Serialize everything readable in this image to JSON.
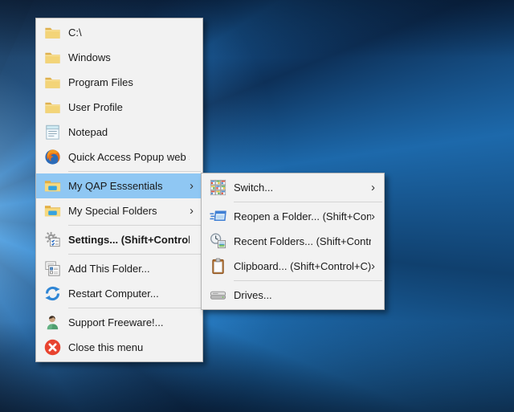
{
  "desktop": {
    "description": "Windows 10 hero wallpaper desktop"
  },
  "colors": {
    "highlight": "#8fc7f3",
    "menu_bg": "#f2f2f2",
    "menu_text": "#1a1a1a",
    "separator": "#d4d4d4"
  },
  "menu": {
    "name": "Quick Access Popup main menu",
    "items": [
      {
        "id": "c-drive",
        "label": "C:\\",
        "icon": "folder-icon",
        "submenu": false,
        "separator_after": false
      },
      {
        "id": "windows",
        "label": "Windows",
        "icon": "folder-icon",
        "submenu": false,
        "separator_after": false
      },
      {
        "id": "program-files",
        "label": "Program Files",
        "icon": "folder-icon",
        "submenu": false,
        "separator_after": false
      },
      {
        "id": "user-profile",
        "label": "User Profile",
        "icon": "folder-icon",
        "submenu": false,
        "separator_after": false
      },
      {
        "id": "notepad",
        "label": "Notepad",
        "icon": "notepad-icon",
        "submenu": false,
        "separator_after": false
      },
      {
        "id": "qap-web-site",
        "label": "Quick Access Popup web site",
        "icon": "firefox-icon",
        "submenu": false,
        "separator_after": true
      },
      {
        "id": "my-qap-essentials",
        "label": "My QAP Esssentials",
        "icon": "live-folder-icon",
        "submenu": true,
        "highlighted": true,
        "separator_after": false
      },
      {
        "id": "my-special-folders",
        "label": "My Special Folders",
        "icon": "live-folder-icon",
        "submenu": true,
        "separator_after": true
      },
      {
        "id": "settings",
        "label": "Settings... (Shift+Control+S)",
        "icon": "settings-icon",
        "submenu": false,
        "bold": true,
        "separator_after": true
      },
      {
        "id": "add-this-folder",
        "label": "Add This Folder...",
        "icon": "add-folder-icon",
        "submenu": false,
        "separator_after": false
      },
      {
        "id": "restart-computer",
        "label": "Restart Computer...",
        "icon": "restart-icon",
        "submenu": false,
        "separator_after": true
      },
      {
        "id": "support-freeware",
        "label": "Support Freeware!...",
        "icon": "support-icon",
        "submenu": false,
        "separator_after": false
      },
      {
        "id": "close-this-menu",
        "label": "Close this menu",
        "icon": "close-icon",
        "submenu": false,
        "separator_after": false
      }
    ]
  },
  "submenu": {
    "name": "My QAP Essentials submenu",
    "items": [
      {
        "id": "switch",
        "label": "Switch...",
        "icon": "switch-icon",
        "submenu": true,
        "separator_after": true
      },
      {
        "id": "reopen-a-folder",
        "label": "Reopen a Folder... (Shift+Control+F)",
        "icon": "reopen-icon",
        "submenu": true,
        "separator_after": false
      },
      {
        "id": "recent-folders",
        "label": "Recent Folders... (Shift+Control+R)",
        "icon": "recent-icon",
        "submenu": false,
        "separator_after": false
      },
      {
        "id": "clipboard",
        "label": "Clipboard... (Shift+Control+C)",
        "icon": "clipboard-icon",
        "submenu": true,
        "separator_after": true
      },
      {
        "id": "drives",
        "label": "Drives...",
        "icon": "drives-icon",
        "submenu": false,
        "separator_after": false
      }
    ]
  },
  "glyphs": {
    "submenu_arrow": "›"
  }
}
